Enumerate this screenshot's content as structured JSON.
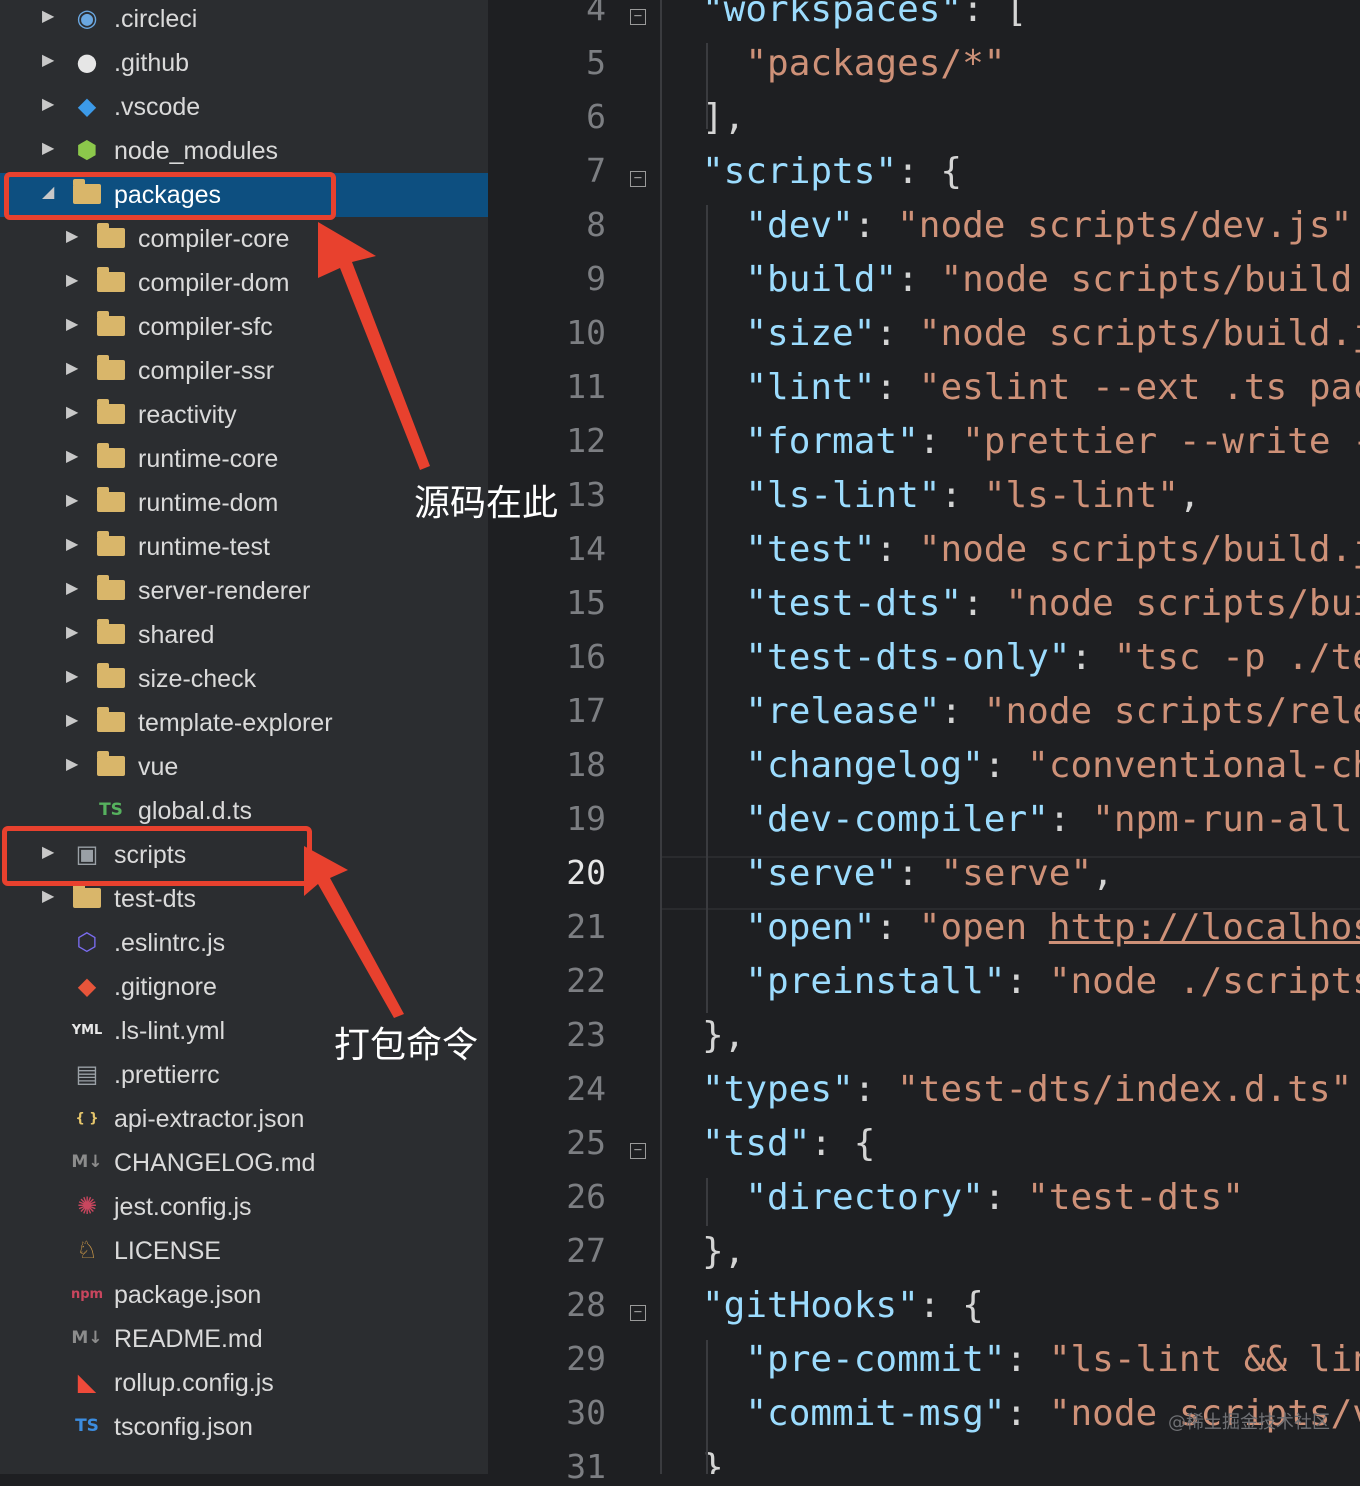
{
  "explorer": {
    "items": [
      {
        "label": ".circleci",
        "icon": "circleci-icon",
        "type": "folder",
        "depth": 0
      },
      {
        "label": ".github",
        "icon": "github-icon",
        "type": "folder",
        "depth": 0
      },
      {
        "label": ".vscode",
        "icon": "vscode-icon",
        "type": "folder",
        "depth": 0
      },
      {
        "label": "node_modules",
        "icon": "node-modules-icon",
        "type": "folder",
        "depth": 0
      },
      {
        "label": "packages",
        "icon": "folder-open-icon",
        "type": "folder",
        "depth": 0,
        "expanded": true,
        "selected": true
      },
      {
        "label": "compiler-core",
        "icon": "folder-icon",
        "type": "folder",
        "depth": 1
      },
      {
        "label": "compiler-dom",
        "icon": "folder-icon",
        "type": "folder",
        "depth": 1
      },
      {
        "label": "compiler-sfc",
        "icon": "folder-icon",
        "type": "folder",
        "depth": 1
      },
      {
        "label": "compiler-ssr",
        "icon": "folder-icon",
        "type": "folder",
        "depth": 1
      },
      {
        "label": "reactivity",
        "icon": "folder-icon",
        "type": "folder",
        "depth": 1
      },
      {
        "label": "runtime-core",
        "icon": "folder-icon",
        "type": "folder",
        "depth": 1
      },
      {
        "label": "runtime-dom",
        "icon": "folder-icon",
        "type": "folder",
        "depth": 1
      },
      {
        "label": "runtime-test",
        "icon": "folder-icon",
        "type": "folder",
        "depth": 1
      },
      {
        "label": "server-renderer",
        "icon": "folder-icon",
        "type": "folder",
        "depth": 1
      },
      {
        "label": "shared",
        "icon": "folder-icon",
        "type": "folder",
        "depth": 1
      },
      {
        "label": "size-check",
        "icon": "folder-icon",
        "type": "folder",
        "depth": 1
      },
      {
        "label": "template-explorer",
        "icon": "folder-icon",
        "type": "folder",
        "depth": 1
      },
      {
        "label": "vue",
        "icon": "folder-icon",
        "type": "folder",
        "depth": 1
      },
      {
        "label": "global.d.ts",
        "icon": "typescript-icon",
        "type": "file",
        "depth": 1
      },
      {
        "label": "scripts",
        "icon": "scripts-folder-icon",
        "type": "folder",
        "depth": 0
      },
      {
        "label": "test-dts",
        "icon": "folder-icon",
        "type": "folder",
        "depth": 0
      },
      {
        "label": ".eslintrc.js",
        "icon": "eslint-icon",
        "type": "file",
        "depth": 0
      },
      {
        "label": ".gitignore",
        "icon": "git-icon",
        "type": "file",
        "depth": 0
      },
      {
        "label": ".ls-lint.yml",
        "icon": "yaml-icon",
        "type": "file",
        "depth": 0
      },
      {
        "label": ".prettierrc",
        "icon": "prettier-icon",
        "type": "file",
        "depth": 0
      },
      {
        "label": "api-extractor.json",
        "icon": "json-icon",
        "type": "file",
        "depth": 0
      },
      {
        "label": "CHANGELOG.md",
        "icon": "markdown-icon",
        "type": "file",
        "depth": 0
      },
      {
        "label": "jest.config.js",
        "icon": "jest-icon",
        "type": "file",
        "depth": 0
      },
      {
        "label": "LICENSE",
        "icon": "license-icon",
        "type": "file",
        "depth": 0
      },
      {
        "label": "package.json",
        "icon": "npm-icon",
        "type": "file",
        "depth": 0
      },
      {
        "label": "README.md",
        "icon": "markdown-icon",
        "type": "file",
        "depth": 0
      },
      {
        "label": "rollup.config.js",
        "icon": "rollup-icon",
        "type": "file",
        "depth": 0
      },
      {
        "label": "tsconfig.json",
        "icon": "tsconfig-icon",
        "type": "file",
        "depth": 0
      }
    ]
  },
  "annotations": {
    "source_label": "源码在此",
    "build_label": "打包命令"
  },
  "editor": {
    "current_line": "20",
    "lines": [
      {
        "num": "4",
        "fold": true,
        "tokens": [
          [
            "k",
            "\"workspaces\""
          ],
          [
            "p",
            ": ["
          ]
        ]
      },
      {
        "num": "5",
        "tokens": [
          [
            "p",
            "  "
          ],
          [
            "s",
            "\"packages/*\""
          ]
        ]
      },
      {
        "num": "6",
        "tokens": [
          [
            "p",
            "],"
          ]
        ]
      },
      {
        "num": "7",
        "fold": true,
        "tokens": [
          [
            "k",
            "\"scripts\""
          ],
          [
            "p",
            ": {"
          ]
        ]
      },
      {
        "num": "8",
        "tokens": [
          [
            "p",
            "  "
          ],
          [
            "k",
            "\"dev\""
          ],
          [
            "p",
            ": "
          ],
          [
            "s",
            "\"node scripts/dev.js\""
          ]
        ]
      },
      {
        "num": "9",
        "tokens": [
          [
            "p",
            "  "
          ],
          [
            "k",
            "\"build\""
          ],
          [
            "p",
            ": "
          ],
          [
            "s",
            "\"node scripts/build"
          ]
        ]
      },
      {
        "num": "10",
        "tokens": [
          [
            "p",
            "  "
          ],
          [
            "k",
            "\"size\""
          ],
          [
            "p",
            ": "
          ],
          [
            "s",
            "\"node scripts/build.j"
          ]
        ]
      },
      {
        "num": "11",
        "tokens": [
          [
            "p",
            "  "
          ],
          [
            "k",
            "\"lint\""
          ],
          [
            "p",
            ": "
          ],
          [
            "s",
            "\"eslint --ext .ts pac"
          ]
        ]
      },
      {
        "num": "12",
        "tokens": [
          [
            "p",
            "  "
          ],
          [
            "k",
            "\"format\""
          ],
          [
            "p",
            ": "
          ],
          [
            "s",
            "\"prettier --write -"
          ]
        ]
      },
      {
        "num": "13",
        "tokens": [
          [
            "p",
            "  "
          ],
          [
            "k",
            "\"ls-lint\""
          ],
          [
            "p",
            ": "
          ],
          [
            "s",
            "\"ls-lint\""
          ],
          [
            "p",
            ","
          ]
        ]
      },
      {
        "num": "14",
        "tokens": [
          [
            "p",
            "  "
          ],
          [
            "k",
            "\"test\""
          ],
          [
            "p",
            ": "
          ],
          [
            "s",
            "\"node scripts/build.j"
          ]
        ]
      },
      {
        "num": "15",
        "tokens": [
          [
            "p",
            "  "
          ],
          [
            "k",
            "\"test-dts\""
          ],
          [
            "p",
            ": "
          ],
          [
            "s",
            "\"node scripts/bui"
          ]
        ]
      },
      {
        "num": "16",
        "tokens": [
          [
            "p",
            "  "
          ],
          [
            "k",
            "\"test-dts-only\""
          ],
          [
            "p",
            ": "
          ],
          [
            "s",
            "\"tsc -p ./te"
          ]
        ]
      },
      {
        "num": "17",
        "tokens": [
          [
            "p",
            "  "
          ],
          [
            "k",
            "\"release\""
          ],
          [
            "p",
            ": "
          ],
          [
            "s",
            "\"node scripts/rele"
          ]
        ]
      },
      {
        "num": "18",
        "tokens": [
          [
            "p",
            "  "
          ],
          [
            "k",
            "\"changelog\""
          ],
          [
            "p",
            ": "
          ],
          [
            "s",
            "\"conventional-ch"
          ]
        ]
      },
      {
        "num": "19",
        "tokens": [
          [
            "p",
            "  "
          ],
          [
            "k",
            "\"dev-compiler\""
          ],
          [
            "p",
            ": "
          ],
          [
            "s",
            "\"npm-run-all"
          ]
        ]
      },
      {
        "num": "20",
        "tokens": [
          [
            "p",
            "  "
          ],
          [
            "k",
            "\"serve\""
          ],
          [
            "p",
            ": "
          ],
          [
            "s",
            "\"serve\""
          ],
          [
            "p",
            ","
          ]
        ]
      },
      {
        "num": "21",
        "tokens": [
          [
            "p",
            "  "
          ],
          [
            "k",
            "\"open\""
          ],
          [
            "p",
            ": "
          ],
          [
            "s",
            "\"open "
          ],
          [
            "u",
            "http://localhos"
          ]
        ]
      },
      {
        "num": "22",
        "tokens": [
          [
            "p",
            "  "
          ],
          [
            "k",
            "\"preinstall\""
          ],
          [
            "p",
            ": "
          ],
          [
            "s",
            "\"node ./scripts"
          ]
        ]
      },
      {
        "num": "23",
        "tokens": [
          [
            "p",
            "},"
          ]
        ]
      },
      {
        "num": "24",
        "tokens": [
          [
            "k",
            "\"types\""
          ],
          [
            "p",
            ": "
          ],
          [
            "s",
            "\"test-dts/index.d.ts\""
          ]
        ]
      },
      {
        "num": "25",
        "fold": true,
        "tokens": [
          [
            "k",
            "\"tsd\""
          ],
          [
            "p",
            ": {"
          ]
        ]
      },
      {
        "num": "26",
        "tokens": [
          [
            "p",
            "  "
          ],
          [
            "k",
            "\"directory\""
          ],
          [
            "p",
            ": "
          ],
          [
            "s",
            "\"test-dts\""
          ]
        ]
      },
      {
        "num": "27",
        "tokens": [
          [
            "p",
            "},"
          ]
        ]
      },
      {
        "num": "28",
        "fold": true,
        "tokens": [
          [
            "k",
            "\"gitHooks\""
          ],
          [
            "p",
            ": {"
          ]
        ]
      },
      {
        "num": "29",
        "tokens": [
          [
            "p",
            "  "
          ],
          [
            "k",
            "\"pre-commit\""
          ],
          [
            "p",
            ": "
          ],
          [
            "s",
            "\"ls-lint && lin"
          ]
        ]
      },
      {
        "num": "30",
        "tokens": [
          [
            "p",
            "  "
          ],
          [
            "k",
            "\"commit-msg\""
          ],
          [
            "p",
            ": "
          ],
          [
            "s",
            "\"node scripts/v"
          ]
        ]
      },
      {
        "num": "31",
        "tokens": [
          [
            "p",
            "}"
          ]
        ]
      }
    ]
  },
  "watermark": "@稀土掘金技术社区",
  "colors": {
    "sidebar_bg": "#2b2d30",
    "selection": "#0d4f80",
    "annotation_red": "#e8412e",
    "key_blue": "#9cdcfe",
    "string_orange": "#ce9178"
  }
}
